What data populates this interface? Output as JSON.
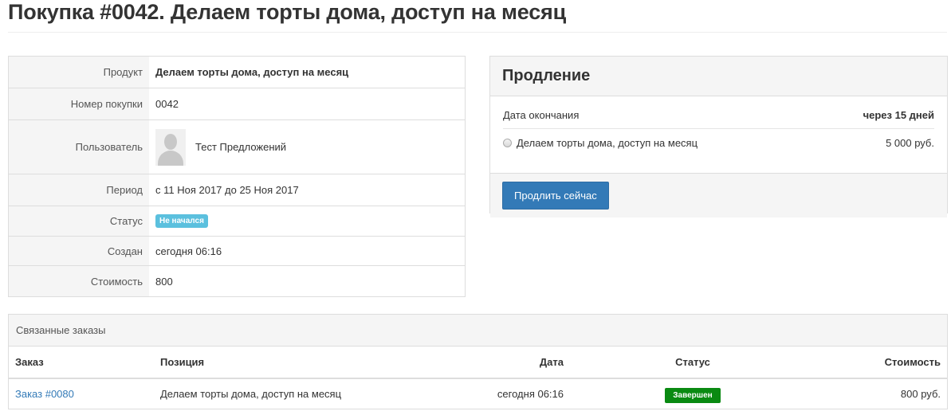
{
  "page": {
    "title": "Покупка #0042. Делаем торты дома, доступ на месяц"
  },
  "details": {
    "rows": [
      {
        "label": "Продукт",
        "value": "Делаем торты дома, доступ на месяц"
      },
      {
        "label": "Номер покупки",
        "value": "0042"
      },
      {
        "label": "Пользователь",
        "value": "Тест Предложений"
      },
      {
        "label": "Период",
        "value": "с 11 Ноя 2017 до 25 Ноя 2017"
      },
      {
        "label": "Статус",
        "value": "Не начался"
      },
      {
        "label": "Создан",
        "value": "сегодня 06:16"
      },
      {
        "label": "Стоимость",
        "value": "800"
      }
    ]
  },
  "renewal": {
    "title": "Продление",
    "end_date_label": "Дата окончания",
    "end_date_value": "через 15 дней",
    "option_label": "Делаем торты дома, доступ на месяц",
    "option_price": "5 000 руб.",
    "button_label": "Продлить сейчас"
  },
  "orders": {
    "title": "Связанные заказы",
    "columns": [
      "Заказ",
      "Позиция",
      "Дата",
      "Статус",
      "Стоимость"
    ],
    "rows": [
      {
        "order": "Заказ #0080",
        "item": "Делаем торты дома, доступ на месяц",
        "date": "сегодня 06:16",
        "status": "Завершен",
        "cost": "800 руб."
      }
    ]
  },
  "colors": {
    "accent": "#337ab7",
    "info_badge": "#5bc0de",
    "success_badge": "#0a8a12"
  }
}
